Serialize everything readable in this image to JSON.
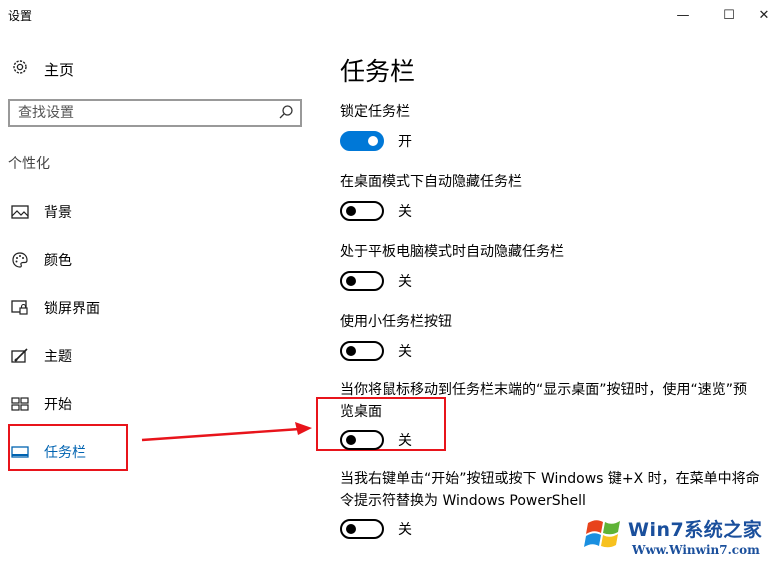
{
  "window": {
    "title": "设置",
    "min_glyph": "—",
    "max_glyph": "☐",
    "close_glyph": "✕"
  },
  "sidebar": {
    "home_label": "主页",
    "search_placeholder": "查找设置",
    "section_label": "个性化",
    "items": [
      {
        "label": "背景",
        "icon": "picture-icon"
      },
      {
        "label": "颜色",
        "icon": "palette-icon"
      },
      {
        "label": "锁屏界面",
        "icon": "lock-screen-icon"
      },
      {
        "label": "主题",
        "icon": "theme-icon"
      },
      {
        "label": "开始",
        "icon": "start-icon"
      },
      {
        "label": "任务栏",
        "icon": "taskbar-icon",
        "active": true
      }
    ]
  },
  "main": {
    "title": "任务栏",
    "settings": [
      {
        "label": "锁定任务栏",
        "state": "开",
        "on": true
      },
      {
        "label": "在桌面模式下自动隐藏任务栏",
        "state": "关",
        "on": false
      },
      {
        "label": "处于平板电脑模式时自动隐藏任务栏",
        "state": "关",
        "on": false
      },
      {
        "label": "使用小任务栏按钮",
        "state": "关",
        "on": false
      },
      {
        "label": "当你将鼠标移动到任务栏末端的“显示桌面”按钮时，使用“速览”预览桌面",
        "state": "关",
        "on": false
      },
      {
        "label": "当我右键单击“开始”按钮或按下 Windows 键+X 时，在菜单中将命令提示符替换为 Windows PowerShell",
        "state": "关",
        "on": false
      }
    ]
  },
  "watermark": {
    "line1": "Win7系统之家",
    "line2": "Www.Winwin7.com"
  },
  "colors": {
    "accent": "#0078d7",
    "active_nav": "#0063b1",
    "annotation_red": "#e8141b"
  }
}
